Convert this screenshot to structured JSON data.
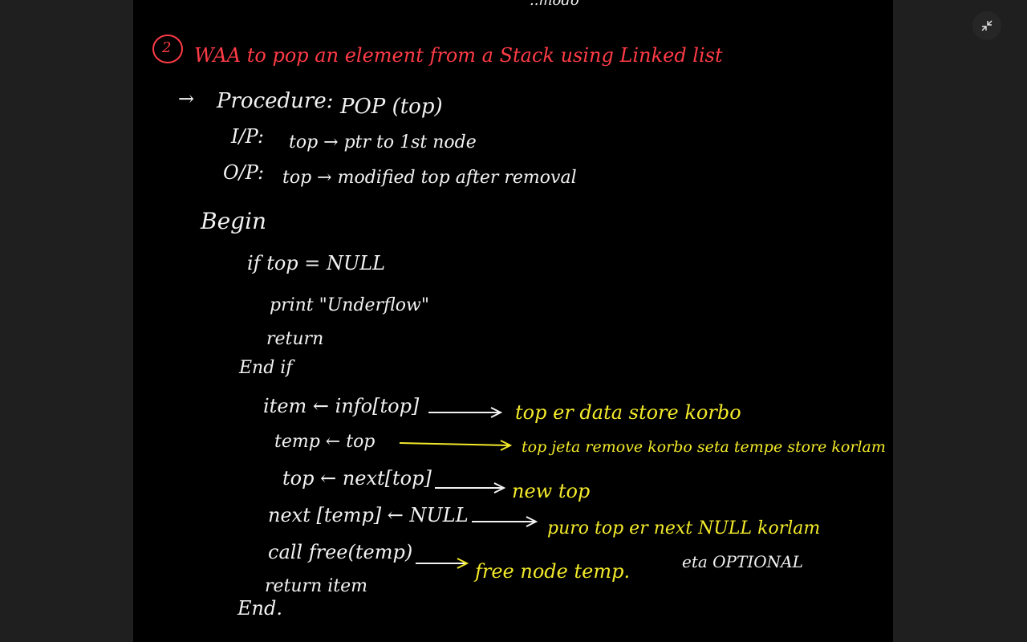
{
  "header_fragment": "..modo",
  "problem": {
    "number": "2",
    "title": "WAA to pop an element from a Stack using Linked list"
  },
  "procedure": {
    "arrow": "→",
    "label": "Procedure:",
    "signature": "POP (top)",
    "input_label": "I/P:",
    "input_text": "top → ptr to 1st node",
    "output_label": "O/P:",
    "output_text": "top → modified top after removal"
  },
  "algorithm": {
    "begin": "Begin",
    "if_line": "if top = NULL",
    "print_line": "print \"Underflow\"",
    "return_line": "return",
    "end_if": "End if",
    "steps": [
      {
        "code": "item ← info[top]",
        "note": "top er data store korbo"
      },
      {
        "code": "temp ← top",
        "note": "top jeta remove korbo seta tempe store korlam"
      },
      {
        "code": "top ← next[top]",
        "note": "new top"
      },
      {
        "code": "next [temp] ← NULL",
        "note": "puro top er next NULL korlam"
      },
      {
        "code": "call free(temp)",
        "note": "free node temp."
      }
    ],
    "optional_note": "eta OPTIONAL",
    "return_item": "return item",
    "end": "End."
  },
  "colors": {
    "ink_white": "#f2f2f2",
    "ink_yellow": "#f3ea2a",
    "ink_red": "#ff3b46",
    "canvas": "#000000",
    "frame": "#1f1f1f"
  },
  "icons": {
    "minimize": "collapse-arrows-icon"
  }
}
